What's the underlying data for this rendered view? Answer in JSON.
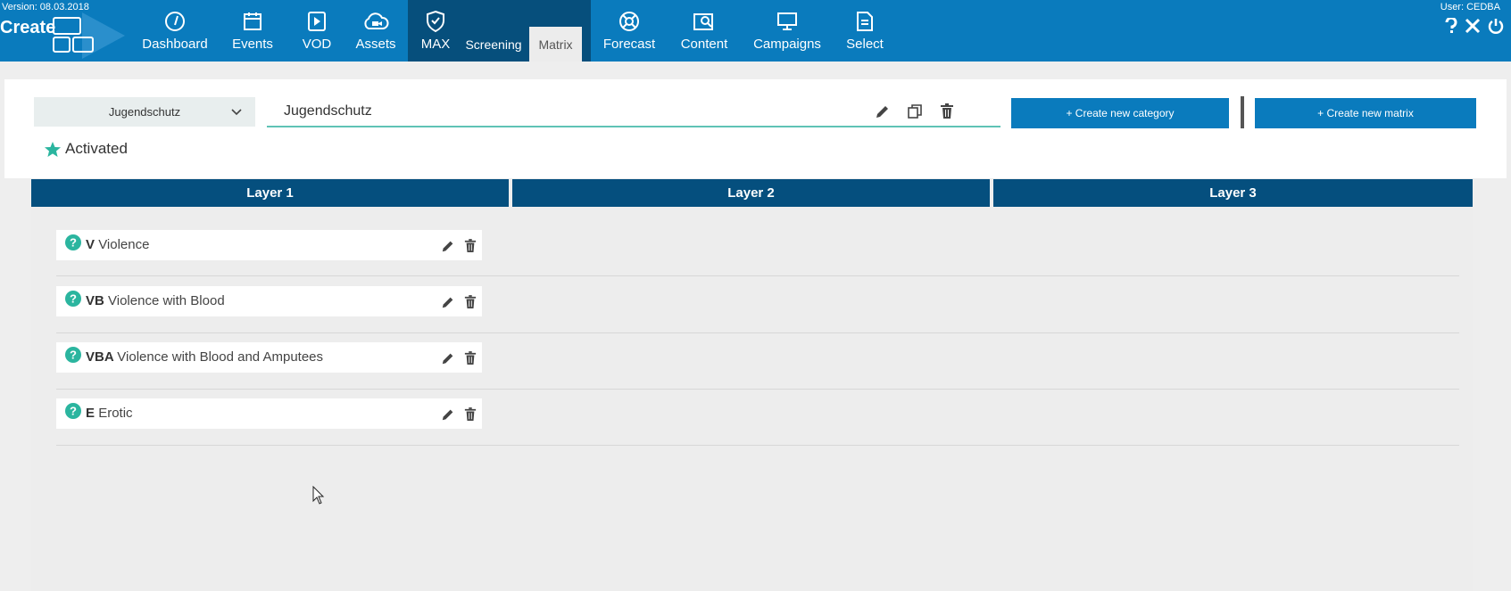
{
  "header": {
    "version": "Version: 08.03.2018",
    "user": "User: CEDBA",
    "logo_text": "Create"
  },
  "nav": {
    "dashboard": "Dashboard",
    "events": "Events",
    "vod": "VOD",
    "assets": "Assets",
    "max": "MAX",
    "screening": "Screening",
    "matrix": "Matrix",
    "forecast": "Forecast",
    "content": "Content",
    "campaigns": "Campaigns",
    "select": "Select"
  },
  "toolbar": {
    "matrix_select_value": "Jugendschutz",
    "matrix_name_value": "Jugendschutz",
    "create_category_label": "+ Create new category",
    "create_matrix_label": "+ Create new matrix",
    "status_label": "Activated"
  },
  "layers": [
    "Layer 1",
    "Layer 2",
    "Layer 3"
  ],
  "categories": [
    {
      "code": "V",
      "label": "Violence"
    },
    {
      "code": "VB",
      "label": "Violence with Blood"
    },
    {
      "code": "VBA",
      "label": "Violence with Blood and Amputees"
    },
    {
      "code": "E",
      "label": "Erotic"
    }
  ],
  "colors": {
    "nav_blue": "#0a7bbd",
    "nav_dark": "#064f7c",
    "layer_header": "#054f7e",
    "accent_teal": "#2bb59f"
  }
}
